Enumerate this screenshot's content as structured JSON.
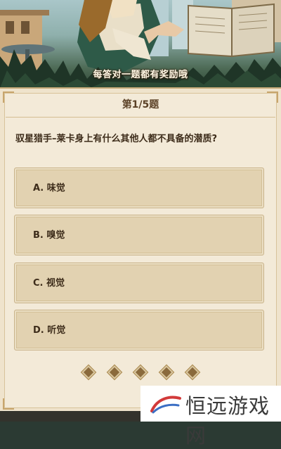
{
  "banner": {
    "caption": "每答对一题都有奖励哦"
  },
  "quiz": {
    "progress_label": "第1/5题",
    "question": "驭星猎手–莱卡身上有什么其他人都不具备的潜质?",
    "options": [
      {
        "label": "A. 味觉"
      },
      {
        "label": "B. 嗅觉"
      },
      {
        "label": "C. 视觉"
      },
      {
        "label": "D. 听觉"
      }
    ],
    "page_dots": 5
  },
  "watermark": {
    "text": "恒远游戏网"
  },
  "colors": {
    "card_bg": "#f3ead8",
    "option_bg": "#e2d2b1",
    "text": "#3d2c1a",
    "accent_gold": "#c7a56c"
  },
  "icons": [
    "hunter-illustration",
    "open-book-icon",
    "diamond-icon",
    "watermark-logo-icon"
  ]
}
